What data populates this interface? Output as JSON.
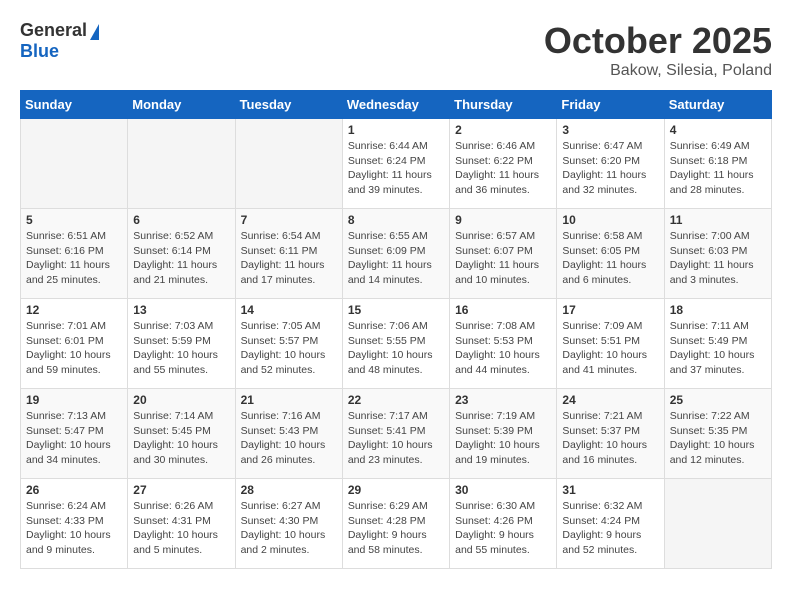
{
  "header": {
    "logo_general": "General",
    "logo_blue": "Blue",
    "title": "October 2025",
    "subtitle": "Bakow, Silesia, Poland"
  },
  "calendar": {
    "headers": [
      "Sunday",
      "Monday",
      "Tuesday",
      "Wednesday",
      "Thursday",
      "Friday",
      "Saturday"
    ],
    "rows": [
      [
        {
          "day": "",
          "detail": ""
        },
        {
          "day": "",
          "detail": ""
        },
        {
          "day": "",
          "detail": ""
        },
        {
          "day": "1",
          "detail": "Sunrise: 6:44 AM\nSunset: 6:24 PM\nDaylight: 11 hours\nand 39 minutes."
        },
        {
          "day": "2",
          "detail": "Sunrise: 6:46 AM\nSunset: 6:22 PM\nDaylight: 11 hours\nand 36 minutes."
        },
        {
          "day": "3",
          "detail": "Sunrise: 6:47 AM\nSunset: 6:20 PM\nDaylight: 11 hours\nand 32 minutes."
        },
        {
          "day": "4",
          "detail": "Sunrise: 6:49 AM\nSunset: 6:18 PM\nDaylight: 11 hours\nand 28 minutes."
        }
      ],
      [
        {
          "day": "5",
          "detail": "Sunrise: 6:51 AM\nSunset: 6:16 PM\nDaylight: 11 hours\nand 25 minutes."
        },
        {
          "day": "6",
          "detail": "Sunrise: 6:52 AM\nSunset: 6:14 PM\nDaylight: 11 hours\nand 21 minutes."
        },
        {
          "day": "7",
          "detail": "Sunrise: 6:54 AM\nSunset: 6:11 PM\nDaylight: 11 hours\nand 17 minutes."
        },
        {
          "day": "8",
          "detail": "Sunrise: 6:55 AM\nSunset: 6:09 PM\nDaylight: 11 hours\nand 14 minutes."
        },
        {
          "day": "9",
          "detail": "Sunrise: 6:57 AM\nSunset: 6:07 PM\nDaylight: 11 hours\nand 10 minutes."
        },
        {
          "day": "10",
          "detail": "Sunrise: 6:58 AM\nSunset: 6:05 PM\nDaylight: 11 hours\nand 6 minutes."
        },
        {
          "day": "11",
          "detail": "Sunrise: 7:00 AM\nSunset: 6:03 PM\nDaylight: 11 hours\nand 3 minutes."
        }
      ],
      [
        {
          "day": "12",
          "detail": "Sunrise: 7:01 AM\nSunset: 6:01 PM\nDaylight: 10 hours\nand 59 minutes."
        },
        {
          "day": "13",
          "detail": "Sunrise: 7:03 AM\nSunset: 5:59 PM\nDaylight: 10 hours\nand 55 minutes."
        },
        {
          "day": "14",
          "detail": "Sunrise: 7:05 AM\nSunset: 5:57 PM\nDaylight: 10 hours\nand 52 minutes."
        },
        {
          "day": "15",
          "detail": "Sunrise: 7:06 AM\nSunset: 5:55 PM\nDaylight: 10 hours\nand 48 minutes."
        },
        {
          "day": "16",
          "detail": "Sunrise: 7:08 AM\nSunset: 5:53 PM\nDaylight: 10 hours\nand 44 minutes."
        },
        {
          "day": "17",
          "detail": "Sunrise: 7:09 AM\nSunset: 5:51 PM\nDaylight: 10 hours\nand 41 minutes."
        },
        {
          "day": "18",
          "detail": "Sunrise: 7:11 AM\nSunset: 5:49 PM\nDaylight: 10 hours\nand 37 minutes."
        }
      ],
      [
        {
          "day": "19",
          "detail": "Sunrise: 7:13 AM\nSunset: 5:47 PM\nDaylight: 10 hours\nand 34 minutes."
        },
        {
          "day": "20",
          "detail": "Sunrise: 7:14 AM\nSunset: 5:45 PM\nDaylight: 10 hours\nand 30 minutes."
        },
        {
          "day": "21",
          "detail": "Sunrise: 7:16 AM\nSunset: 5:43 PM\nDaylight: 10 hours\nand 26 minutes."
        },
        {
          "day": "22",
          "detail": "Sunrise: 7:17 AM\nSunset: 5:41 PM\nDaylight: 10 hours\nand 23 minutes."
        },
        {
          "day": "23",
          "detail": "Sunrise: 7:19 AM\nSunset: 5:39 PM\nDaylight: 10 hours\nand 19 minutes."
        },
        {
          "day": "24",
          "detail": "Sunrise: 7:21 AM\nSunset: 5:37 PM\nDaylight: 10 hours\nand 16 minutes."
        },
        {
          "day": "25",
          "detail": "Sunrise: 7:22 AM\nSunset: 5:35 PM\nDaylight: 10 hours\nand 12 minutes."
        }
      ],
      [
        {
          "day": "26",
          "detail": "Sunrise: 6:24 AM\nSunset: 4:33 PM\nDaylight: 10 hours\nand 9 minutes."
        },
        {
          "day": "27",
          "detail": "Sunrise: 6:26 AM\nSunset: 4:31 PM\nDaylight: 10 hours\nand 5 minutes."
        },
        {
          "day": "28",
          "detail": "Sunrise: 6:27 AM\nSunset: 4:30 PM\nDaylight: 10 hours\nand 2 minutes."
        },
        {
          "day": "29",
          "detail": "Sunrise: 6:29 AM\nSunset: 4:28 PM\nDaylight: 9 hours\nand 58 minutes."
        },
        {
          "day": "30",
          "detail": "Sunrise: 6:30 AM\nSunset: 4:26 PM\nDaylight: 9 hours\nand 55 minutes."
        },
        {
          "day": "31",
          "detail": "Sunrise: 6:32 AM\nSunset: 4:24 PM\nDaylight: 9 hours\nand 52 minutes."
        },
        {
          "day": "",
          "detail": ""
        }
      ]
    ]
  }
}
